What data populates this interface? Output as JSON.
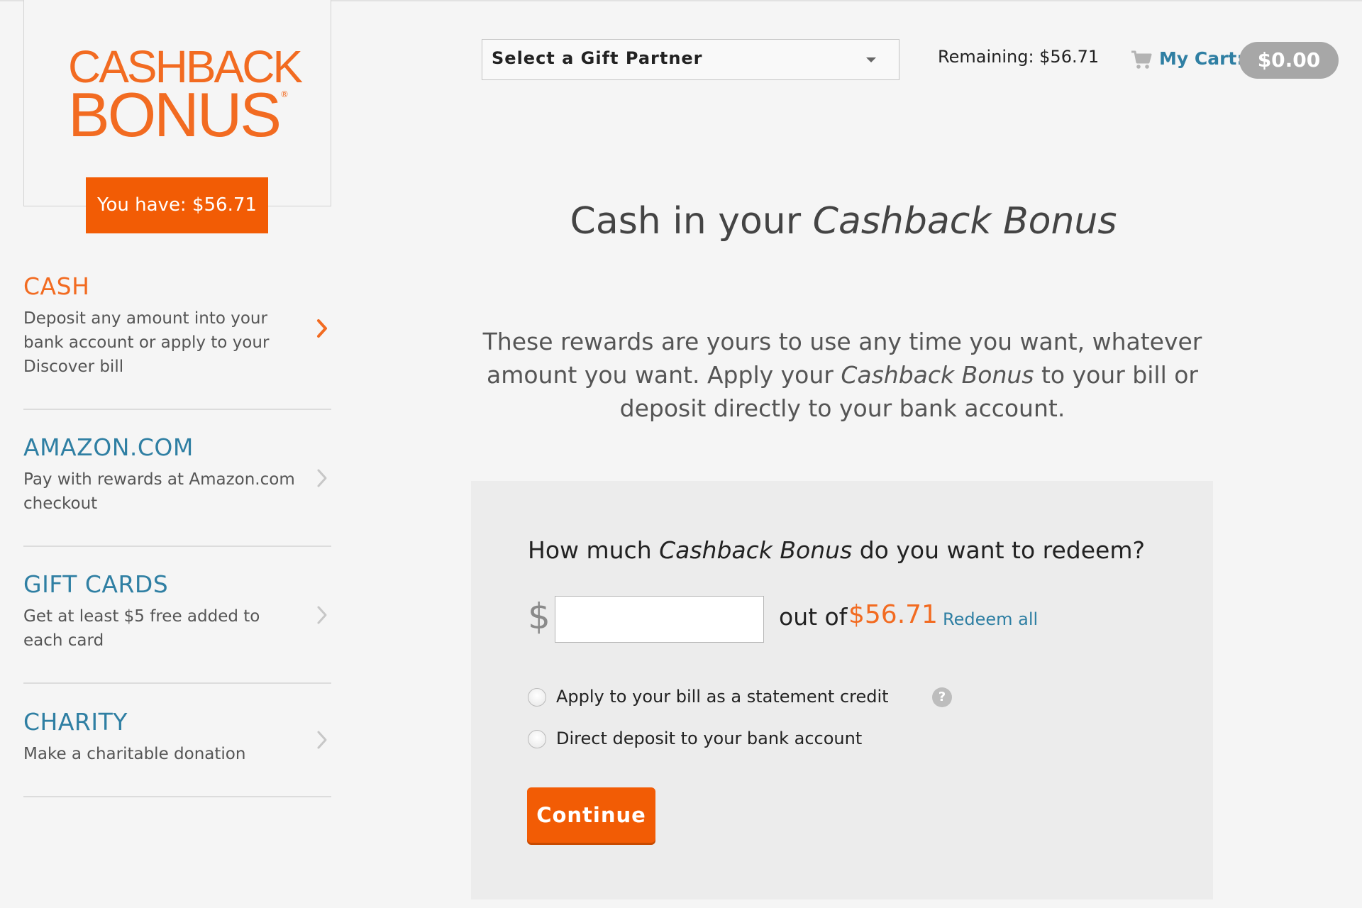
{
  "logo": {
    "line1": "CASHBACK",
    "line2": "BONUS",
    "registered": "®"
  },
  "balance_badge": "You have: $56.71",
  "sidebar": {
    "items": [
      {
        "title": "CASH",
        "description": "Deposit any amount into your bank account or apply to your Discover bill",
        "active": true
      },
      {
        "title": "AMAZON.COM",
        "description": "Pay with rewards at Amazon.com checkout",
        "active": false
      },
      {
        "title": "GIFT CARDS",
        "description": "Get at least $5 free added to each card",
        "active": false
      },
      {
        "title": "CHARITY",
        "description": "Make a charitable donation",
        "active": false
      }
    ]
  },
  "header": {
    "partner_select": "Select a Gift Partner",
    "remaining": "Remaining: $56.71",
    "cart_label": "My Cart:",
    "cart_total": "$0.00"
  },
  "main": {
    "title_plain": "Cash in your ",
    "title_italic": "Cashback Bonus",
    "intro_part1": "These rewards are yours to use any time you want, whatever amount you want. Apply your ",
    "intro_italic": "Cashback Bonus",
    "intro_part2": " to your bill or deposit directly to your bank account."
  },
  "redeem": {
    "question_part1": "How much ",
    "question_italic": "Cashback Bonus",
    "question_part2": " do you want to redeem?",
    "currency_symbol": "$",
    "amount_value": "",
    "out_of_label": "out of",
    "available_amount": "$56.71",
    "redeem_all": "Redeem all",
    "options": [
      {
        "label": "Apply to your bill as a statement credit",
        "selected": false
      },
      {
        "label": "Direct deposit to your bank account",
        "selected": false
      }
    ],
    "help_glyph": "?",
    "continue_label": "Continue"
  },
  "colors": {
    "brand_orange": "#f25c05",
    "logo_orange": "#f26b21",
    "link_blue": "#2f7fa3",
    "background": "#f5f5f5",
    "panel": "#ececec",
    "cart_pill": "#a7a7a7"
  },
  "icons": {
    "menu_chevron": "chevron-right-icon",
    "select_caret": "caret-down-icon",
    "cart": "shopping-cart-icon",
    "help": "help-circle-icon",
    "radio": "radio-button-icon"
  }
}
